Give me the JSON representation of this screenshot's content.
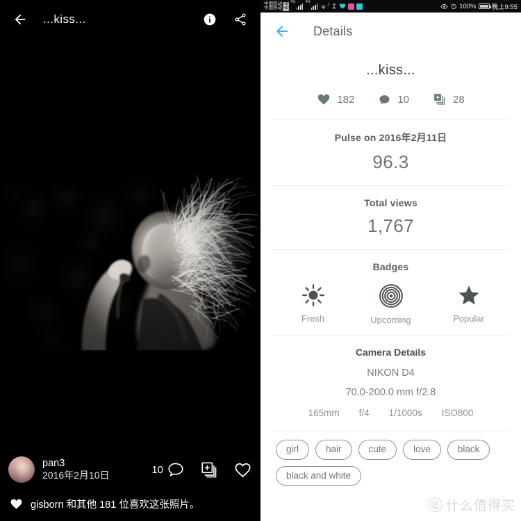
{
  "left_panel": {
    "title": "...kiss...",
    "back_icon": "arrow-left-icon",
    "info_icon": "info-icon",
    "share_icon": "share-icon",
    "photo_alt": "black and white photo of a girl with windblown hair",
    "user": {
      "name": "pan3",
      "date": "2016年2月10日"
    },
    "comment_count": "10",
    "likes_text": "gisborn 和其他 181 位喜欢这张照片。"
  },
  "statusbar": {
    "carrier_line1": "中国移动",
    "carrier_line2": "中国移动",
    "hd_badge": "HD",
    "net1": "4G",
    "net2": "4G",
    "wifi_superscript": "2",
    "battery_percent": "100%",
    "clock": "晚上9:55",
    "app_icon_1_color": "#e0559c",
    "app_icon_2_color": "#3bc4c9"
  },
  "details": {
    "header_title": "Details",
    "back_icon": "arrow-left-icon",
    "back_icon_color": "#3fa9f5",
    "photo_title": "...kiss...",
    "stats": [
      {
        "icon": "heart-icon",
        "value": "182"
      },
      {
        "icon": "comment-icon",
        "value": "10"
      },
      {
        "icon": "add-to-gallery-icon",
        "value": "28"
      }
    ],
    "pulse": {
      "label": "Pulse on 2016年2月11日",
      "value": "96.3"
    },
    "views": {
      "label": "Total views",
      "value": "1,767"
    },
    "badges": {
      "label": "Badges",
      "items": [
        {
          "icon": "sun-icon",
          "label": "Fresh"
        },
        {
          "icon": "concentric-circles-icon",
          "label": "Upcoming"
        },
        {
          "icon": "star-icon",
          "label": "Popular"
        }
      ]
    },
    "camera": {
      "label": "Camera Details",
      "body": "NIKON D4",
      "lens": "70.0-200.0 mm f/2.8",
      "exif": [
        "165mm",
        "f/4",
        "1/1000s",
        "ISO800"
      ]
    },
    "tags": [
      "girl",
      "hair",
      "cute",
      "love",
      "black",
      "black and white"
    ]
  },
  "watermark": {
    "mark": "值",
    "text": "什么值得买"
  }
}
